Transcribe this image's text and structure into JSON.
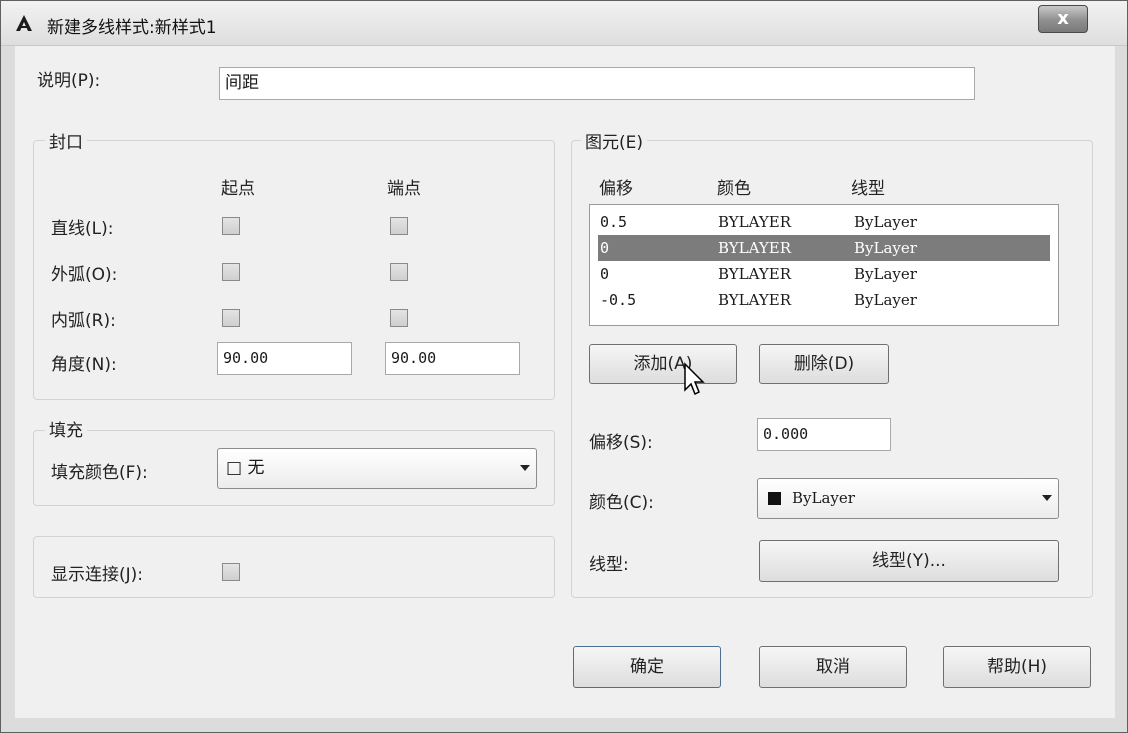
{
  "window": {
    "title": "新建多线样式:新样式1",
    "close_label": "x"
  },
  "description": {
    "label": "说明(P):",
    "value": "间距"
  },
  "caps": {
    "title": "封口",
    "col_start": "起点",
    "col_end": "端点",
    "rows": [
      {
        "label": "直线(L):",
        "start_checked": false,
        "end_checked": false
      },
      {
        "label": "外弧(O):",
        "start_checked": false,
        "end_checked": false
      },
      {
        "label": "内弧(R):",
        "start_checked": false,
        "end_checked": false
      }
    ],
    "angle": {
      "label": "角度(N):",
      "start": "90.00",
      "end": "90.00"
    }
  },
  "fill": {
    "title": "填充",
    "label": "填充颜色(F):",
    "value": "□ 无"
  },
  "joints": {
    "label": "显示连接(J):",
    "checked": false
  },
  "elements": {
    "title": "图元(E)",
    "headers": {
      "offset": "偏移",
      "color": "颜色",
      "linetype": "线型"
    },
    "rows": [
      {
        "offset": "0.5",
        "color": "BYLAYER",
        "linetype": "ByLayer",
        "selected": false
      },
      {
        "offset": "0",
        "color": "BYLAYER",
        "linetype": "ByLayer",
        "selected": true
      },
      {
        "offset": "0",
        "color": "BYLAYER",
        "linetype": "ByLayer",
        "selected": false
      },
      {
        "offset": "-0.5",
        "color": "BYLAYER",
        "linetype": "ByLayer",
        "selected": false
      }
    ],
    "add_label": "添加(A)",
    "delete_label": "删除(D)",
    "offset_label": "偏移(S):",
    "offset_value": "0.000",
    "color_label": "颜色(C):",
    "color_value": "ByLayer",
    "linetype_label": "线型:",
    "linetype_button": "线型(Y)..."
  },
  "buttons": {
    "ok": "确定",
    "cancel": "取消",
    "help": "帮助(H)"
  },
  "colors": {
    "selected_row": "#7c7c7c",
    "dialog_bg": "#f0f0f0"
  }
}
